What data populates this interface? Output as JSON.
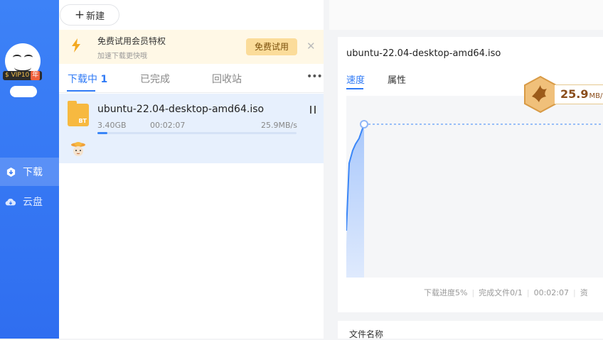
{
  "colors": {
    "accent": "#2f7af6",
    "sidebar": "#3378f5",
    "promo_bg": "#fff8e6",
    "selected_row": "#e7f0fd"
  },
  "sidebar": {
    "vip": {
      "label": "VIP10",
      "year": "年"
    },
    "items": [
      {
        "label": "下载",
        "icon": "download-icon",
        "active": true
      },
      {
        "label": "云盘",
        "icon": "cloud-icon",
        "active": false
      }
    ]
  },
  "toolbar": {
    "new_label": "新建",
    "new_icon": "plus-icon"
  },
  "promo": {
    "title": "免费试用会员特权",
    "subtitle": "加速下载更快哦",
    "button": "免费试用",
    "icon": "lightning-icon",
    "close_icon": "close-icon"
  },
  "tabs": {
    "downloading": "下载中",
    "downloading_count": "1",
    "completed": "已完成",
    "recycle": "回收站",
    "more": "•••"
  },
  "task": {
    "name": "ubuntu-22.04-desktop-amd64.iso",
    "size": "3.40GB",
    "time": "00:02:07",
    "speed": "25.9MB/s",
    "progress": 0.05,
    "type_label": "BT"
  },
  "detail": {
    "title": "ubuntu-22.04-desktop-amd64.iso",
    "tab_speed": "速度",
    "tab_props": "属性",
    "speed_value": "25.9",
    "speed_unit": "MB/s",
    "stats": {
      "progress": "下载进度5%",
      "files": "完成文件0/1",
      "time": "00:02:07",
      "resource": "资"
    },
    "files_header": "文件名称"
  }
}
